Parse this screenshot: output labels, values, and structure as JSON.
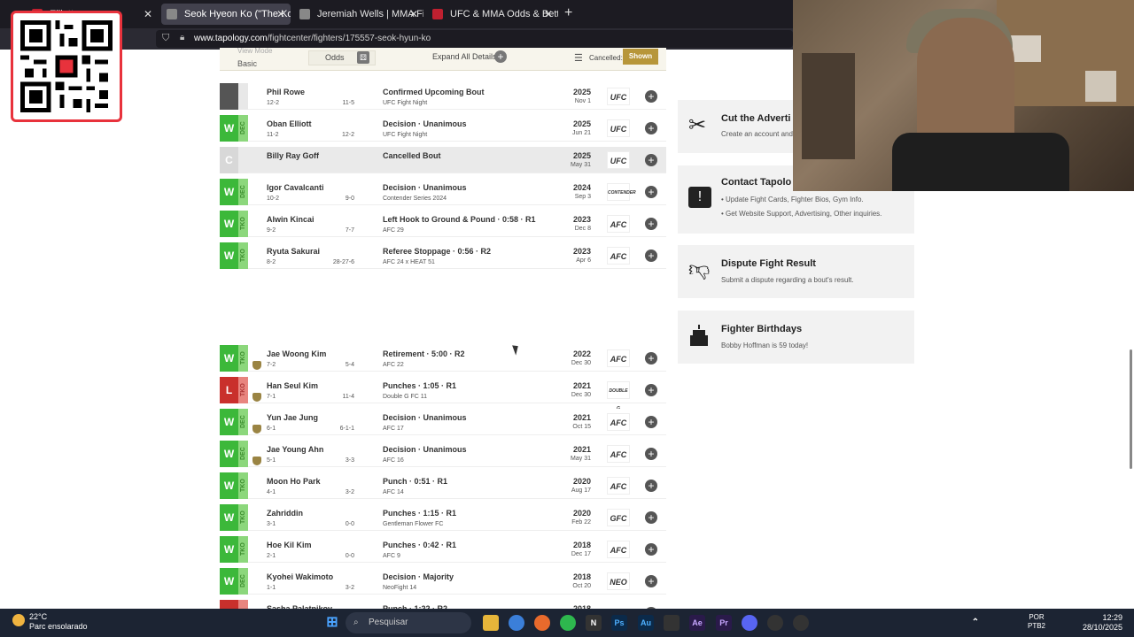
{
  "browser": {
    "tabs": [
      {
        "label": "Elliott",
        "color": "#c02030"
      },
      {
        "label": "Seok Hyeon Ko (\"The Korean Tig",
        "color": "#888888"
      },
      {
        "label": "Jeremiah Wells | MMA Fighter P",
        "color": "#888888"
      },
      {
        "label": "UFC & MMA Odds & Betting Lin",
        "color": "#c02030"
      }
    ],
    "url_domain": "www.tapology.com",
    "url_path": "/fightcenter/fighters/175557-seok-hyun-ko"
  },
  "toolbar": {
    "view_mode_label": "View Mode",
    "view_mode_value": "Basic",
    "odds_label": "Odds",
    "expand_label": "Expand All Details",
    "cancelled_label": "Cancelled:",
    "shown_label": "Shown"
  },
  "colors": {
    "win": "#3cb83a",
    "win_light": "#8cd77c",
    "loss": "#c9302c",
    "loss_light": "#e8857f",
    "upcoming": "#555555",
    "cancel": "#d8d8d8",
    "accent": "#b7963a"
  },
  "bouts": [
    {
      "result": "",
      "method": "",
      "type": "upcoming",
      "opponent": "Phil Rowe",
      "record": "12-2",
      "opp_record": "11-5",
      "result_text": "Confirmed Upcoming Bout",
      "event": "UFC Fight Night",
      "year": "2025",
      "date": "Nov 1",
      "promo": "UFC",
      "belt": false
    },
    {
      "result": "W",
      "method": "DEC",
      "type": "win",
      "opponent": "Oban Elliott",
      "record": "11-2",
      "opp_record": "12-2",
      "result_text": "Decision · Unanimous",
      "event": "UFC Fight Night",
      "year": "2025",
      "date": "Jun 21",
      "promo": "UFC",
      "belt": false
    },
    {
      "result": "C",
      "method": "",
      "type": "cancel",
      "opponent": "Billy Ray Goff",
      "record": "",
      "opp_record": "",
      "result_text": "Cancelled Bout",
      "event": "",
      "year": "2025",
      "date": "May 31",
      "promo": "UFC",
      "belt": false
    },
    {
      "result": "W",
      "method": "DEC",
      "type": "win",
      "opponent": "Igor Cavalcanti",
      "record": "10-2",
      "opp_record": "9-0",
      "result_text": "Decision · Unanimous",
      "event": "Contender Series 2024",
      "year": "2024",
      "date": "Sep 3",
      "promo": "CONTENDER",
      "belt": false
    },
    {
      "result": "W",
      "method": "TKO",
      "type": "win",
      "opponent": "Alwin Kincai",
      "record": "9-2",
      "opp_record": "7-7",
      "result_text": "Left Hook to Ground & Pound · 0:58 · R1",
      "event": "AFC 29",
      "year": "2023",
      "date": "Dec 8",
      "promo": "AFC",
      "belt": false
    },
    {
      "result": "W",
      "method": "TKO",
      "type": "win",
      "opponent": "Ryuta Sakurai",
      "record": "8-2",
      "opp_record": "28-27-6",
      "result_text": "Referee Stoppage · 0:56 · R2",
      "event": "AFC 24 x HEAT 51",
      "year": "2023",
      "date": "Apr 6",
      "promo": "AFC",
      "belt": false
    },
    {
      "result": "W",
      "method": "TKO",
      "type": "win",
      "opponent": "Jae Woong Kim",
      "record": "7-2",
      "opp_record": "5-4",
      "result_text": "Retirement · 5:00 · R2",
      "event": "AFC 22",
      "year": "2022",
      "date": "Dec 30",
      "promo": "AFC",
      "belt": true
    },
    {
      "result": "L",
      "method": "TKO",
      "type": "loss",
      "opponent": "Han Seul Kim",
      "record": "7-1",
      "opp_record": "11-4",
      "result_text": "Punches · 1:05 · R1",
      "event": "Double G FC 11",
      "year": "2021",
      "date": "Dec 30",
      "promo": "DOUBLE G",
      "belt": true
    },
    {
      "result": "W",
      "method": "DEC",
      "type": "win",
      "opponent": "Yun Jae Jung",
      "record": "6-1",
      "opp_record": "6-1-1",
      "result_text": "Decision · Unanimous",
      "event": "AFC 17",
      "year": "2021",
      "date": "Oct 15",
      "promo": "AFC",
      "belt": true
    },
    {
      "result": "W",
      "method": "DEC",
      "type": "win",
      "opponent": "Jae Young Ahn",
      "record": "5-1",
      "opp_record": "3-3",
      "result_text": "Decision · Unanimous",
      "event": "AFC 16",
      "year": "2021",
      "date": "May 31",
      "promo": "AFC",
      "belt": true
    },
    {
      "result": "W",
      "method": "TKO",
      "type": "win",
      "opponent": "Moon Ho Park",
      "record": "4-1",
      "opp_record": "3-2",
      "result_text": "Punch · 0:51 · R1",
      "event": "AFC 14",
      "year": "2020",
      "date": "Aug 17",
      "promo": "AFC",
      "belt": false
    },
    {
      "result": "W",
      "method": "TKO",
      "type": "win",
      "opponent": "Zahriddin",
      "record": "3-1",
      "opp_record": "0-0",
      "result_text": "Punches · 1:15 · R1",
      "event": "Gentleman Flower FC",
      "year": "2020",
      "date": "Feb 22",
      "promo": "GFC",
      "belt": false
    },
    {
      "result": "W",
      "method": "TKO",
      "type": "win",
      "opponent": "Hoe Kil Kim",
      "record": "2-1",
      "opp_record": "0-0",
      "result_text": "Punches · 0:42 · R1",
      "event": "AFC 9",
      "year": "2018",
      "date": "Dec 17",
      "promo": "AFC",
      "belt": false
    },
    {
      "result": "W",
      "method": "DEC",
      "type": "win",
      "opponent": "Kyohei Wakimoto",
      "record": "1-1",
      "opp_record": "3-2",
      "result_text": "Decision · Majority",
      "event": "NeoFight 14",
      "year": "2018",
      "date": "Oct 20",
      "promo": "NEO",
      "belt": false
    },
    {
      "result": "L",
      "method": "",
      "type": "loss",
      "opponent": "Sasha Palatnikov",
      "record": "",
      "opp_record": "",
      "result_text": "Punch · 1:22 · R2",
      "event": "",
      "year": "2018",
      "date": "",
      "promo": "",
      "belt": false
    }
  ],
  "sidebar": {
    "cards": [
      {
        "title": "Cut the Adverti",
        "lines": [
          "Create an account and"
        ],
        "icon": "scissors-icon"
      },
      {
        "title": "Contact Tapolo",
        "lines": [
          "• Update Fight Cards, Fighter Bios, Gym Info.",
          "• Get Website Support, Advertising, Other inquiries."
        ],
        "icon": "exclamation-chat-icon"
      },
      {
        "title": "Dispute Fight Result",
        "lines": [
          "Submit a dispute regarding a bout's result."
        ],
        "icon": "thumbs-down-icon"
      },
      {
        "title": "Fighter Birthdays",
        "lines": [
          "Bobby Hoffman is 59 today!"
        ],
        "icon": "birthday-cake-icon"
      }
    ]
  },
  "taskbar": {
    "temp": "22°C",
    "weather": "Parc ensolarado",
    "search": "Pesquisar",
    "lang1": "POR",
    "lang2": "PTB2",
    "time": "12:29",
    "date": "28/10/2025"
  }
}
